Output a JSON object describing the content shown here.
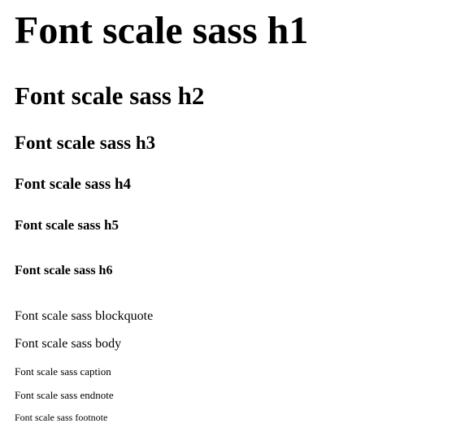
{
  "samples": {
    "h1": "Font scale sass h1",
    "h2": "Font scale sass h2",
    "h3": "Font scale sass h3",
    "h4": "Font scale sass h4",
    "h5": "Font scale sass h5",
    "h6": "Font scale sass h6",
    "blockquote": "Font scale sass blockquote",
    "body": "Font scale sass body",
    "caption": "Font scale sass caption",
    "endnote": "Font scale sass endnote",
    "footnote": "Font scale sass footnote"
  }
}
